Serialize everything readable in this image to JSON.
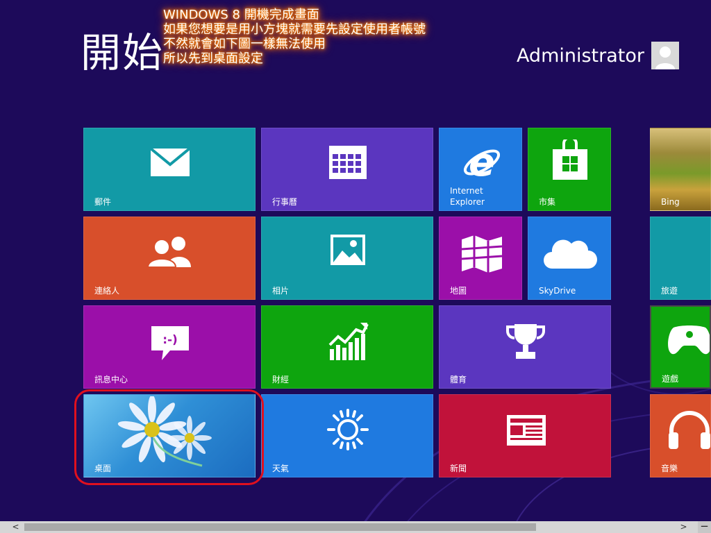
{
  "header": {
    "title": "開始",
    "user_name": "Administrator"
  },
  "annotation": {
    "lines": [
      "WINDOWS 8 開機完成畫面",
      "如果您想要是用小方塊就需要先設定使用者帳號",
      "不然就會如下圖一樣無法使用",
      "所以先到桌面設定"
    ]
  },
  "tiles": {
    "mail": "郵件",
    "calendar": "行事曆",
    "ie_line1": "Internet",
    "ie_line2": "Explorer",
    "store": "市集",
    "bing": "Bing",
    "people": "連絡人",
    "photos": "相片",
    "maps": "地圖",
    "skydrive": "SkyDrive",
    "travel": "旅遊",
    "messaging": "訊息中心",
    "messaging_icon_text": ":-)",
    "finance": "財經",
    "sports": "體育",
    "games": "遊戲",
    "desktop": "桌面",
    "weather": "天氣",
    "news": "新聞",
    "music": "音樂"
  },
  "colors": {
    "background": "#1d0a5a",
    "teal": "#129aa6",
    "purple": "#5b36bf",
    "blue": "#1f7ae0",
    "green": "#0ea50e",
    "orange": "#d84f2b",
    "magenta": "#9b0fa9",
    "red": "#c1123a",
    "highlight": "#e0101e"
  },
  "scrollbar": {
    "left_arrow": "<",
    "right_arrow": ">",
    "zoom": "−"
  }
}
